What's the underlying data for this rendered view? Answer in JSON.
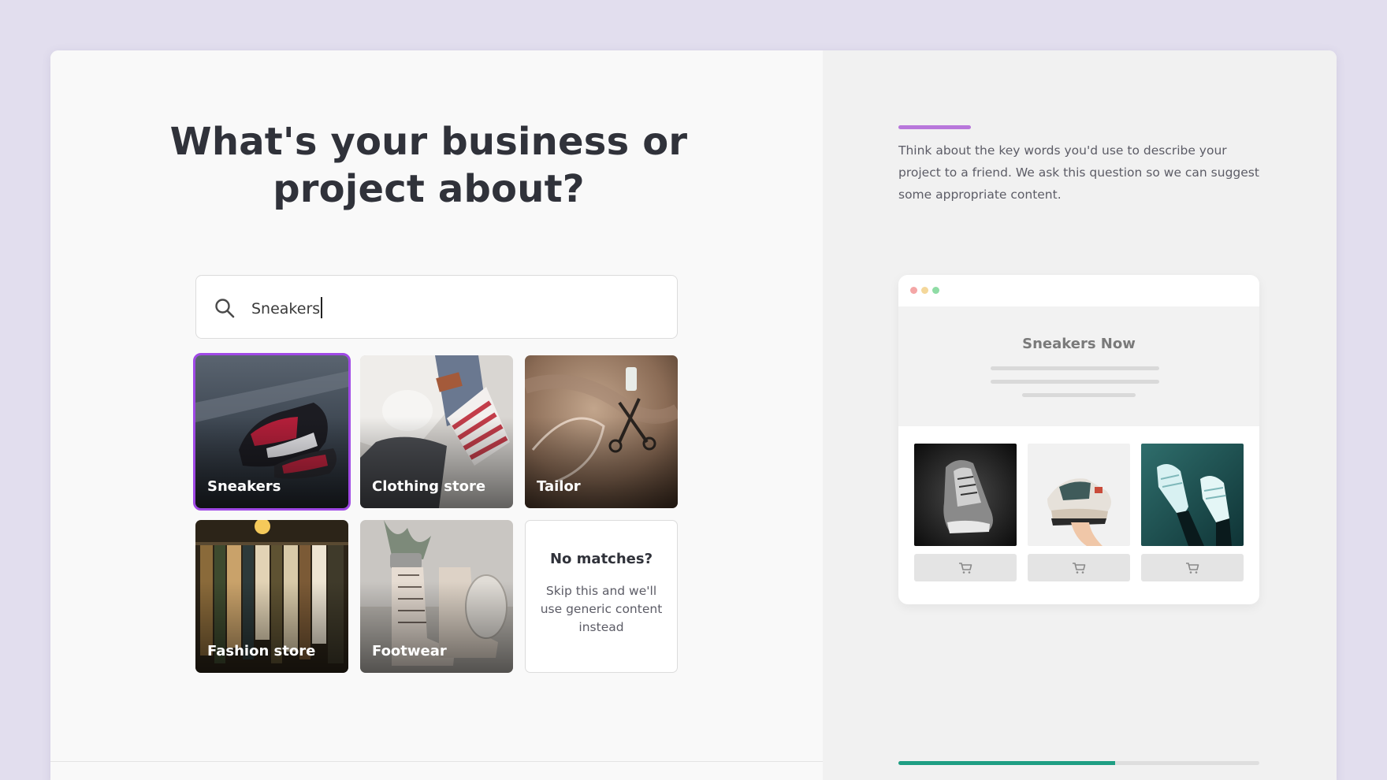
{
  "main": {
    "title": "What's your business or project about?"
  },
  "search": {
    "value": "Sneakers",
    "icon": "search-icon"
  },
  "categories": [
    {
      "label": "Sneakers",
      "selected": true
    },
    {
      "label": "Clothing store",
      "selected": false
    },
    {
      "label": "Tailor",
      "selected": false
    },
    {
      "label": "Fashion store",
      "selected": false
    },
    {
      "label": "Footwear",
      "selected": false
    }
  ],
  "no_match": {
    "title": "No matches?",
    "body": "Skip this and we'll use generic content instead"
  },
  "sidebar": {
    "hint": "Think about the key words you'd use to describe your project to a friend. We ask this question so we can suggest some appropriate content."
  },
  "preview": {
    "site_title": "Sneakers Now",
    "products": [
      {
        "image": "sneaker-bw-photo",
        "button_icon": "cart-icon"
      },
      {
        "image": "sneaker-hand-photo",
        "button_icon": "cart-icon"
      },
      {
        "image": "sneakers-teal-photo",
        "button_icon": "cart-icon"
      }
    ]
  },
  "progress": {
    "fraction": 0.6
  },
  "colors": {
    "accent": "#a049e6",
    "accent_bar": "#b877db",
    "progress": "#1f9e83",
    "dot_red": "#f4a6a6",
    "dot_yellow": "#f4d79a",
    "dot_green": "#8fdca5"
  }
}
